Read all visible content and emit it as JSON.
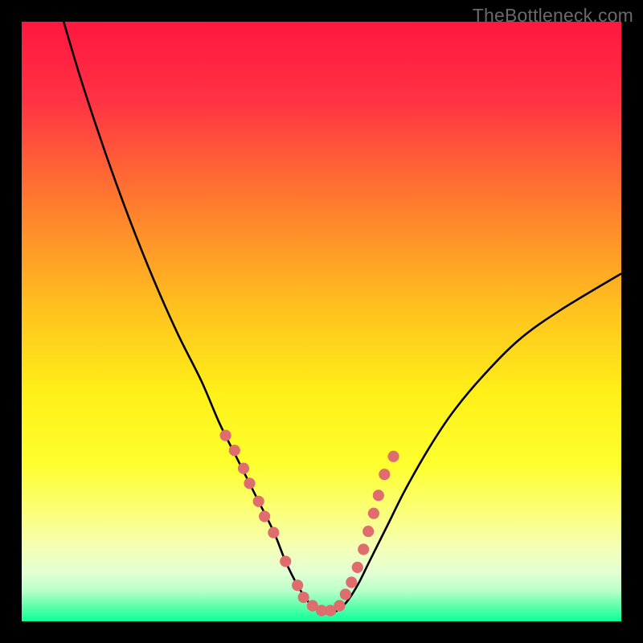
{
  "watermark": "TheBottleneck.com",
  "chart_data": {
    "type": "line",
    "title": "",
    "xlabel": "",
    "ylabel": "",
    "xlim": [
      0,
      100
    ],
    "ylim": [
      0,
      100
    ],
    "grid": false,
    "legend": false,
    "background": {
      "type": "vertical-gradient",
      "stops": [
        {
          "pos": 0.0,
          "color": "#ff173f"
        },
        {
          "pos": 0.13,
          "color": "#ff3244"
        },
        {
          "pos": 0.3,
          "color": "#ff7a2f"
        },
        {
          "pos": 0.48,
          "color": "#ffc21e"
        },
        {
          "pos": 0.62,
          "color": "#fff019"
        },
        {
          "pos": 0.74,
          "color": "#fdff2e"
        },
        {
          "pos": 0.83,
          "color": "#faff86"
        },
        {
          "pos": 0.88,
          "color": "#f4ffb8"
        },
        {
          "pos": 0.92,
          "color": "#e2ffd4"
        },
        {
          "pos": 0.95,
          "color": "#b6ffc8"
        },
        {
          "pos": 0.975,
          "color": "#5fffab"
        },
        {
          "pos": 1.0,
          "color": "#0aff9a"
        }
      ]
    },
    "series": [
      {
        "name": "bottleneck-curve",
        "color": "#000000",
        "type": "line",
        "x": [
          7,
          10,
          14,
          18,
          22,
          26,
          30,
          33,
          36,
          39,
          42,
          44,
          46,
          48,
          50,
          52,
          54,
          56,
          58,
          61,
          64,
          68,
          72,
          77,
          83,
          90,
          100
        ],
        "y": [
          100,
          90,
          78,
          67,
          57,
          48,
          40,
          33,
          27,
          21,
          15,
          10,
          6,
          3,
          1.5,
          1.5,
          3,
          6,
          10,
          16,
          22,
          29,
          35,
          41,
          47,
          52,
          58
        ]
      },
      {
        "name": "sample-dots",
        "color": "#e06d6d",
        "type": "scatter",
        "x": [
          34,
          35.5,
          37,
          38,
          39.5,
          40.5,
          42,
          44,
          46,
          47,
          48.5,
          50,
          51.5,
          53,
          54,
          55,
          56,
          57,
          57.8,
          58.7,
          59.5,
          60.5,
          62
        ],
        "y": [
          31,
          28.5,
          25.5,
          23,
          20,
          17.5,
          14.8,
          10,
          6,
          4,
          2.6,
          1.8,
          1.8,
          2.6,
          4.5,
          6.5,
          9,
          12,
          15,
          18,
          21,
          24.5,
          27.5
        ]
      }
    ]
  }
}
